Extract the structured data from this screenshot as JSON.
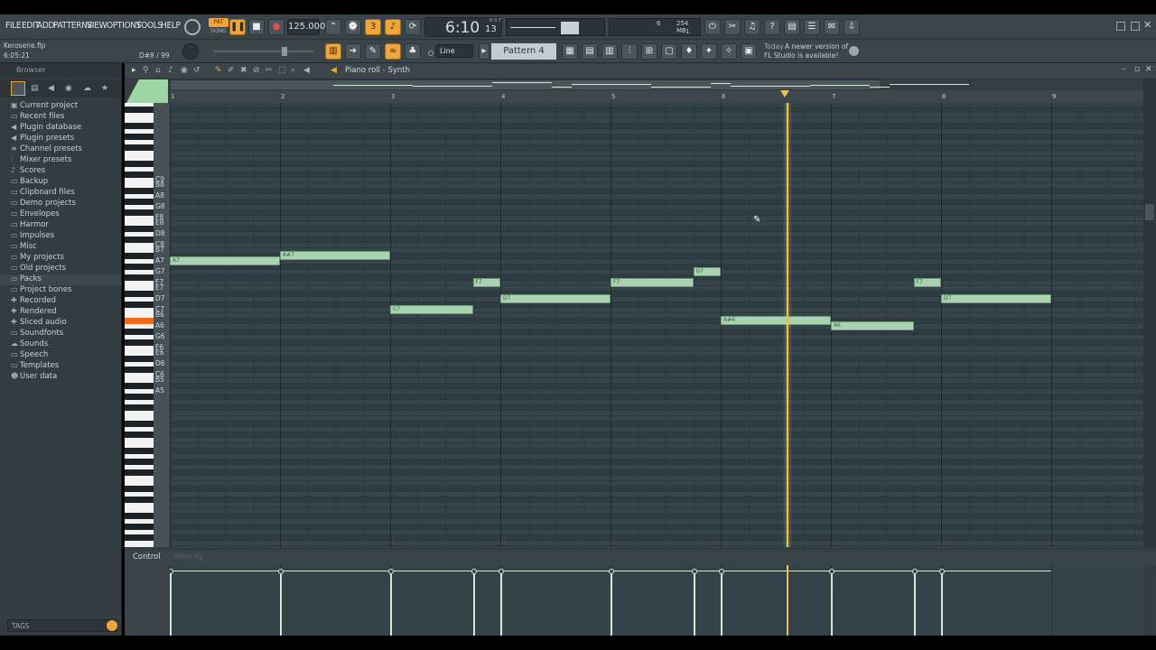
{
  "menu": [
    "FILE",
    "EDIT",
    "ADD",
    "PATTERNS",
    "VIEW",
    "OPTIONS",
    "TOOLS",
    "HELP"
  ],
  "transport": {
    "pat_label": "PAT",
    "song_label": "SONG",
    "tempo": "125.000",
    "time": "6:10",
    "time_ticks": "13",
    "time_unit": "B:S:T",
    "cpu": "6",
    "memory": "254 MB",
    "polyphony": "1"
  },
  "project": {
    "file": "Kerosene.flp",
    "position": "6:05:21",
    "hint": "D#8 / 99"
  },
  "snap": "Line",
  "pattern": "Pattern 4",
  "notification": {
    "when": "Today",
    "line1": "A newer version of",
    "line2": "FL Studio is available!"
  },
  "browser": {
    "title": "Browser",
    "items": [
      {
        "label": "Current project",
        "icon": "project-icon"
      },
      {
        "label": "Recent files",
        "icon": "folder-icon"
      },
      {
        "label": "Plugin database",
        "icon": "plug-icon"
      },
      {
        "label": "Plugin presets",
        "icon": "plug-icon"
      },
      {
        "label": "Channel presets",
        "icon": "channel-icon"
      },
      {
        "label": "Mixer presets",
        "icon": "mixer-icon"
      },
      {
        "label": "Scores",
        "icon": "note-icon"
      },
      {
        "label": "Backup",
        "icon": "folder-icon"
      },
      {
        "label": "Clipboard files",
        "icon": "folder-icon"
      },
      {
        "label": "Demo projects",
        "icon": "folder-icon"
      },
      {
        "label": "Envelopes",
        "icon": "folder-icon"
      },
      {
        "label": "Harmor",
        "icon": "folder-icon"
      },
      {
        "label": "Impulses",
        "icon": "folder-icon"
      },
      {
        "label": "Misc",
        "icon": "folder-icon"
      },
      {
        "label": "My projects",
        "icon": "folder-icon"
      },
      {
        "label": "Old projects",
        "icon": "folder-icon"
      },
      {
        "label": "Packs",
        "icon": "folder-icon"
      },
      {
        "label": "Project bones",
        "icon": "folder-icon"
      },
      {
        "label": "Recorded",
        "icon": "mic-icon"
      },
      {
        "label": "Rendered",
        "icon": "render-icon"
      },
      {
        "label": "Sliced audio",
        "icon": "slice-icon"
      },
      {
        "label": "Soundfonts",
        "icon": "folder-icon"
      },
      {
        "label": "Sounds",
        "icon": "cloud-icon"
      },
      {
        "label": "Speech",
        "icon": "folder-icon"
      },
      {
        "label": "Templates",
        "icon": "folder-icon"
      },
      {
        "label": "User data",
        "icon": "user-icon"
      }
    ],
    "tags_label": "TAGS"
  },
  "piano_roll": {
    "title": "Piano roll - Synth",
    "bars": [
      "1",
      "2",
      "3",
      "4",
      "5",
      "6",
      "7",
      "8",
      "9"
    ],
    "key_labels": [
      "C9",
      "B8",
      "A8",
      "G8",
      "F8",
      "E8",
      "D8",
      "C8",
      "B7",
      "A7",
      "G7",
      "F7",
      "E7",
      "D7",
      "C7",
      "B6",
      "A6",
      "G6",
      "F6",
      "E6",
      "D6",
      "C6",
      "B5",
      "A5"
    ],
    "notes": [
      {
        "pitch": "A7",
        "label": "A7",
        "start": 1.0,
        "length": 1.0
      },
      {
        "pitch": "A#7",
        "label": "A#7",
        "start": 2.0,
        "length": 1.0
      },
      {
        "pitch": "C7",
        "label": "C7",
        "start": 3.0,
        "length": 0.75
      },
      {
        "pitch": "F7",
        "label": "F7",
        "start": 3.75,
        "length": 0.25
      },
      {
        "pitch": "D7",
        "label": "D7",
        "start": 4.0,
        "length": 1.0
      },
      {
        "pitch": "F7",
        "label": "F7",
        "start": 5.0,
        "length": 0.75
      },
      {
        "pitch": "G7",
        "label": "G7",
        "start": 5.75,
        "length": 0.25
      },
      {
        "pitch": "A#6",
        "label": "A#6",
        "start": 6.0,
        "length": 1.0
      },
      {
        "pitch": "A6",
        "label": "A6",
        "start": 7.0,
        "length": 0.75
      },
      {
        "pitch": "F7",
        "label": "F7",
        "start": 7.75,
        "length": 0.25
      },
      {
        "pitch": "D7",
        "label": "D7",
        "start": 8.0,
        "length": 1.0
      }
    ],
    "playhead_bar": 6.6
  },
  "control": {
    "label": "Control",
    "target": "Velocity"
  },
  "colors": {
    "note": "#a9d3b0",
    "accent": "#f0a53a",
    "playhead": "#e4c34e",
    "grid_bg": "#34434a"
  }
}
